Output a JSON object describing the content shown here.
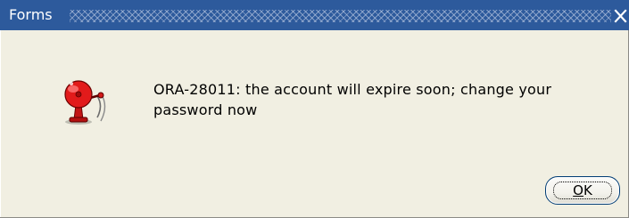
{
  "window": {
    "title": "Forms",
    "close_glyph": "✕"
  },
  "dialog": {
    "icon": "alarm-bell-icon",
    "message": "ORA-28011: the account will expire soon; change your password now"
  },
  "buttons": {
    "ok": {
      "mnemonic": "O",
      "rest": "K"
    }
  },
  "colors": {
    "titlebar": "#2d5a9c",
    "dialog_background": "#f1efe2",
    "bell_red": "#e21b1b",
    "button_border": "#003c74"
  }
}
